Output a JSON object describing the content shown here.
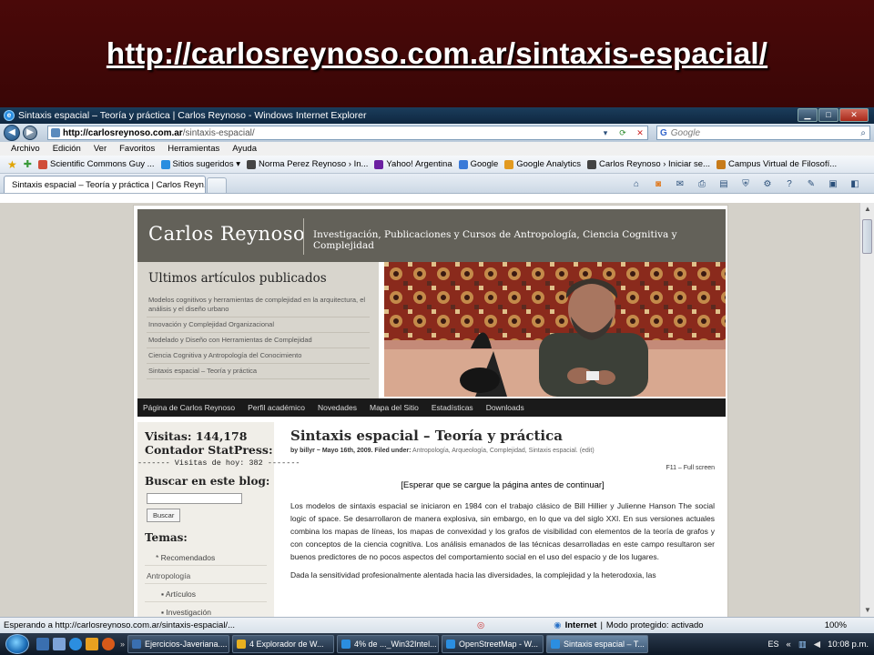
{
  "slide": {
    "title": "http://carlosreynoso.com.ar/sintaxis-espacial/"
  },
  "browser": {
    "window_title": "Sintaxis espacial – Teoría y práctica | Carlos Reynoso - Windows Internet Explorer",
    "address": {
      "host": "http://carlosreynoso.com.ar",
      "path": "/sintaxis-espacial/"
    },
    "search_placeholder": "Google",
    "menu": [
      "Archivo",
      "Edición",
      "Ver",
      "Favoritos",
      "Herramientas",
      "Ayuda"
    ],
    "favorites": [
      {
        "label": "Scientific Commons Guy ...",
        "color": "#d04d3a"
      },
      {
        "label": "Sitios sugeridos ▾",
        "color": "#2a8ee0"
      },
      {
        "label": "Norma Perez Reynoso › In...",
        "color": "#444444"
      },
      {
        "label": "Yahoo! Argentina",
        "color": "#6b1fa1"
      },
      {
        "label": "Google",
        "color": "#3a7ad8"
      },
      {
        "label": "Google Analytics",
        "color": "#e29a20"
      },
      {
        "label": "Carlos Reynoso › Iniciar se...",
        "color": "#444444"
      },
      {
        "label": "Campus Virtual de Filosofí...",
        "color": "#c77b1a"
      }
    ],
    "tab_label": "Sintaxis espacial – Teoría y práctica | Carlos Reyn...",
    "status_text": "Esperando a http://carlosreynoso.com.ar/sintaxis-espacial/...",
    "zone_label": "Internet",
    "zone_mode": "Modo protegido: activado",
    "zoom": "100%"
  },
  "site": {
    "name": "Carlos Reynoso",
    "tagline": "Investigación, Publicaciones y Cursos de Antropología, Ciencia Cognitiva y Complejidad",
    "recent_heading": "Ultimos artículos publicados",
    "recent_items": [
      "Modelos cognitivos y herramientas de complejidad en la arquitectura, el análisis y el diseño urbano",
      "Innovación y Complejidad Organizacional",
      "Modelado y Diseño con Herramientas de Complejidad",
      "Ciencia Cognitiva y Antropología del Conocimiento",
      "Sintaxis espacial – Teoría y práctica"
    ],
    "nav": [
      "Página de Carlos Reynoso",
      "Perfil académico",
      "Novedades",
      "Mapa del Sitio",
      "Estadísticas",
      "Downloads"
    ],
    "sidebar": {
      "visits": "Visitas: 144,178",
      "counter": "Contador StatPress:",
      "today": "------- Visitas de hoy: 382 -------",
      "search_heading": "Buscar en este blog:",
      "search_button": "Buscar",
      "topics_heading": "Temas:",
      "topics": [
        "* Recomendados",
        "Antropología",
        "▪ Artículos",
        "▪ Investigación"
      ]
    },
    "post": {
      "title": "Sintaxis espacial – Teoría y práctica",
      "byline_prefix": "by billyr ~ Mayo 16th, 2009. Filed under:",
      "byline_cats": "Antropología, Arqueología, Complejidad, Sintaxis espacial. (edit)",
      "f11": "F11 – Full screen",
      "wait": "[Esperar que se cargue la página antes de continuar]",
      "para1": "Los modelos de sintaxis espacial se iniciaron en 1984 con el trabajo clásico de Bill Hillier y Julienne Hanson The social logic of space. Se desarrollaron de manera explosiva, sin embargo, en lo que va del siglo XXI. En sus versiones actuales combina los mapas de líneas, los mapas de convexidad y los grafos de visibilidad con elementos de la teoría de grafos y con conceptos de la ciencia cognitiva. Los análisis emanados de las técnicas desarrolladas en este campo resultaron ser buenos predictores de no pocos aspectos del comportamiento social en el uso del espacio y de los lugares.",
      "para2": "Dada la sensitividad profesionalmente alentada hacia las diversidades, la complejidad y la heterodoxia, las"
    }
  },
  "taskbar": {
    "buttons": [
      {
        "label": "Ejercicios-Javeriana....",
        "width": 112
      },
      {
        "label": "4 Explorador de W...",
        "width": 112
      },
      {
        "label": "4% de ..._Win32Intel...",
        "width": 112
      },
      {
        "label": "OpenStreetMap - W...",
        "width": 112
      },
      {
        "label": "Sintaxis espacial – T...",
        "width": 112
      }
    ],
    "lang": "ES",
    "clock": "10:08 p.m."
  }
}
